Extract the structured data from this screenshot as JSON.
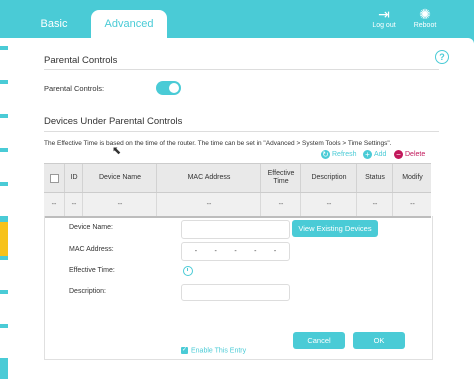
{
  "tabs": [
    {
      "label": "Basic"
    },
    {
      "label": "Advanced"
    }
  ],
  "toolbar": {
    "logout_label": "Log out",
    "reboot_label": "Reboot"
  },
  "section1": {
    "title": "Parental Controls",
    "toggle_label": "Parental Controls:",
    "toggle_on": true
  },
  "section2": {
    "title": "Devices Under Parental Controls",
    "note": "The Effective Time is based on the time of the router. The time can be set in \"Advanced > System Tools > Time Settings\".",
    "actions": {
      "refresh": "Refresh",
      "add": "Add",
      "delete": "Delete"
    }
  },
  "table": {
    "headers": [
      "",
      "ID",
      "Device Name",
      "MAC Address",
      "Effective Time",
      "Description",
      "Status",
      "Modify"
    ],
    "row": [
      "--",
      "--",
      "--",
      "--",
      "--",
      "--",
      "--",
      "--"
    ]
  },
  "form": {
    "device_name_label": "Device Name:",
    "mac_label": "MAC Address:",
    "effective_time_label": "Effective Time:",
    "description_label": "Description:",
    "view_button": "View Existing Devices",
    "mac_seps": [
      "-",
      "-",
      "-",
      "-",
      "-"
    ],
    "enable_label": "Enable This Entry",
    "cancel": "Cancel",
    "ok": "OK"
  },
  "colors": {
    "accent": "#4acbd6",
    "delete": "#c2185b",
    "rail_active": "#f7c21a"
  }
}
